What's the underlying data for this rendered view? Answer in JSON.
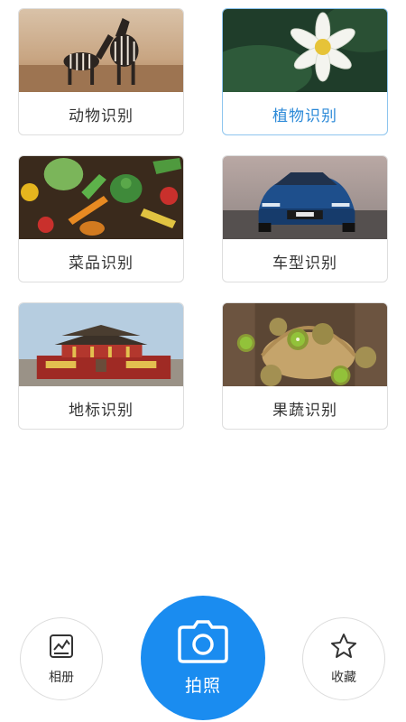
{
  "categories": [
    {
      "label": "动物识别",
      "image": "zebras-photo",
      "selected": false
    },
    {
      "label": "植物识别",
      "image": "lotus-flower-photo",
      "selected": true
    },
    {
      "label": "菜品识别",
      "image": "vegetables-photo",
      "selected": false
    },
    {
      "label": "车型识别",
      "image": "sports-car-photo",
      "selected": false
    },
    {
      "label": "地标识别",
      "image": "tiananmen-photo",
      "selected": false
    },
    {
      "label": "果蔬识别",
      "image": "kiwi-basket-photo",
      "selected": false
    }
  ],
  "bottom_bar": {
    "album_label": "相册",
    "shoot_label": "拍照",
    "favorites_label": "收藏",
    "album_icon": "album-icon",
    "shoot_icon": "camera-icon",
    "favorites_icon": "star-icon"
  },
  "colors": {
    "accent": "#1a8cf0",
    "selected_text": "#2c8ad8",
    "selected_border": "#8ec5ee"
  }
}
